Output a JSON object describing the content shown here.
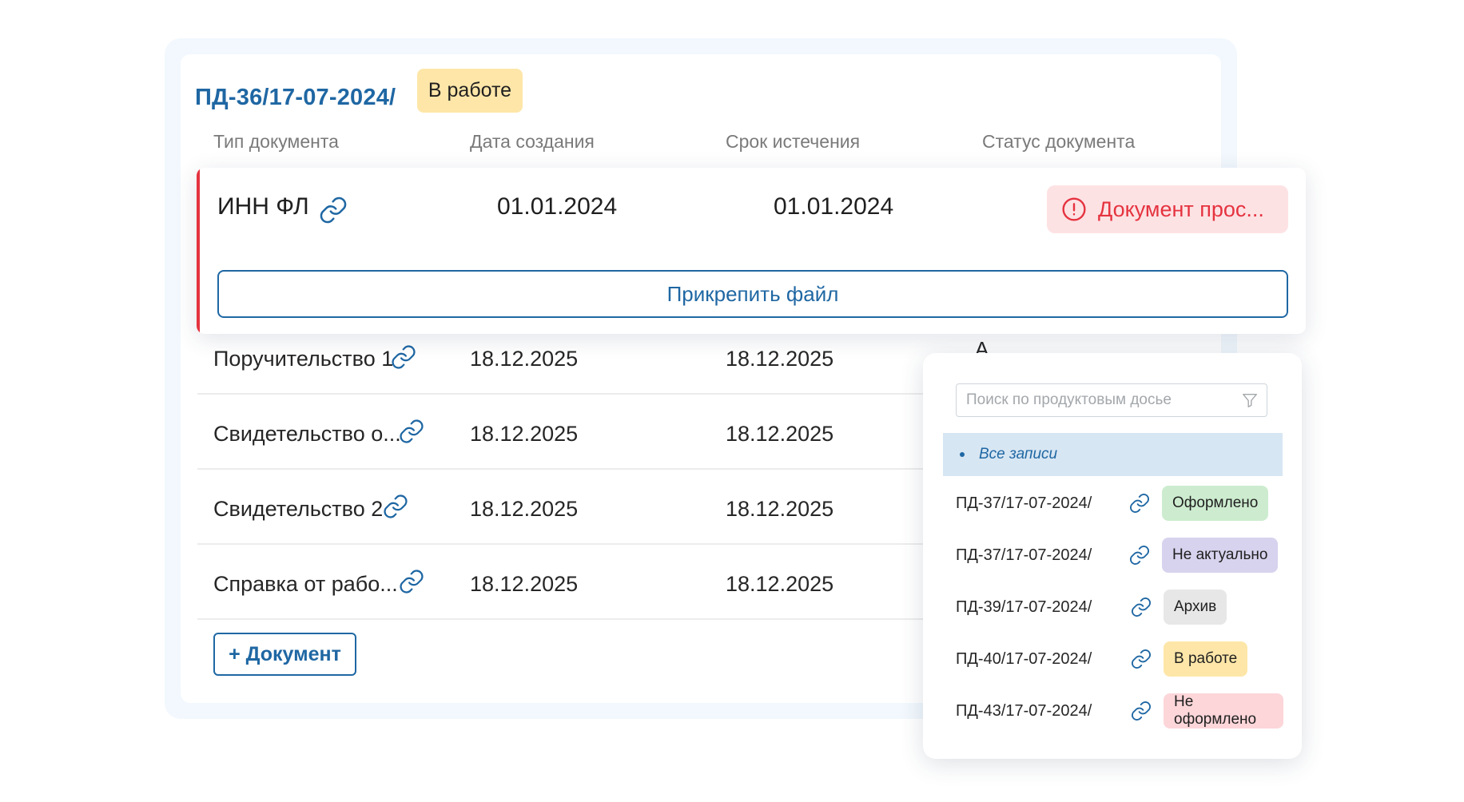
{
  "header": {
    "dossier_code": "ПД-36/17-07-2024/",
    "status": "В работе",
    "status_color": "#fde6a8"
  },
  "columns": [
    "Тип документа",
    "Дата создания",
    "Срок истечения",
    "Статус документа"
  ],
  "expanded_row": {
    "doc_type": "ИНН ФЛ",
    "created": "01.01.2024",
    "expires": "01.01.2024",
    "status": "Документ прос...",
    "status_color": "#e5333f",
    "attach_label": "Прикрепить файл"
  },
  "rows": [
    {
      "doc_type": "Поручительство 1",
      "created": "18.12.2025",
      "expires": "18.12.2025"
    },
    {
      "doc_type": "Свидетельство о...",
      "created": "18.12.2025",
      "expires": "18.12.2025"
    },
    {
      "doc_type": "Свидетельство 2",
      "created": "18.12.2025",
      "expires": "18.12.2025"
    },
    {
      "doc_type": "Справка от рабо...",
      "created": "18.12.2025",
      "expires": "18.12.2025"
    }
  ],
  "add_document_label": "+ Документ",
  "dropdown": {
    "search_placeholder": "Поиск по продуктовым досье",
    "all_records_label": "Все записи",
    "items": [
      {
        "code": "ПД-37/17-07-2024/",
        "status": "Оформлено",
        "color": "#cdeccf"
      },
      {
        "code": "ПД-37/17-07-2024/",
        "status": "Не актуально",
        "color": "#d7d3ee"
      },
      {
        "code": "ПД-39/17-07-2024/",
        "status": "Архив",
        "color": "#e7e7e7"
      },
      {
        "code": "ПД-40/17-07-2024/",
        "status": "В работе",
        "color": "#fde6a8"
      },
      {
        "code": "ПД-43/17-07-2024/",
        "status": "Не оформлено",
        "color": "#fcd6d9"
      }
    ]
  },
  "accent_color": "#1f67a3"
}
